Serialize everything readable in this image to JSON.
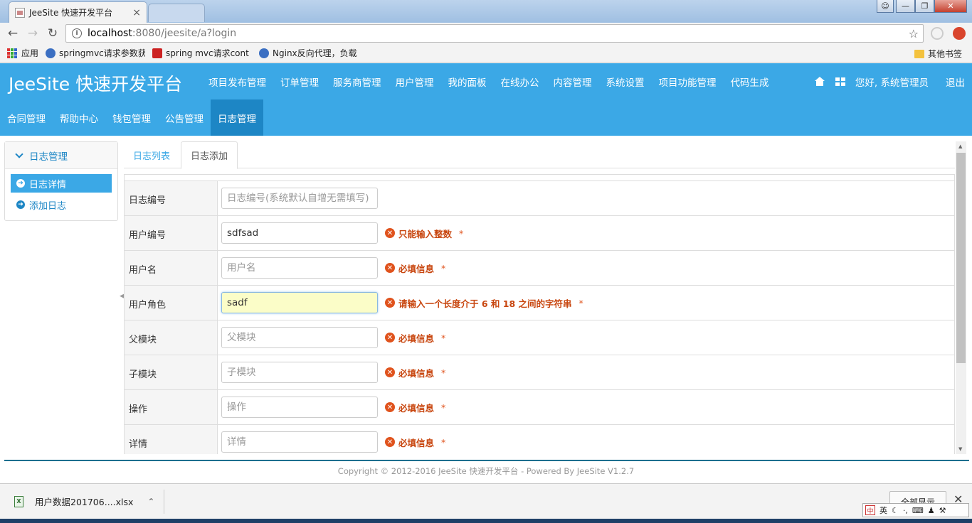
{
  "browser": {
    "tab_title": "JeeSite 快速开发平台",
    "tab_close": "×",
    "url_host": "localhost",
    "url_rest": ":8080/jeesite/a?login",
    "bookmarks": [
      {
        "label": "应用",
        "color": "#d33"
      },
      {
        "label": "springmvc请求参数获",
        "color": "#3b6fc2"
      },
      {
        "label": "spring mvc请求cont",
        "color": "#c22"
      },
      {
        "label": "Nginx反向代理，负载",
        "color": "#3b6fc2"
      }
    ],
    "other_bookmarks": "其他书签"
  },
  "app": {
    "brand": "JeeSite 快速开发平台",
    "main_nav": [
      "项目发布管理",
      "订单管理",
      "服务商管理",
      "用户管理",
      "我的面板",
      "在线办公",
      "内容管理",
      "系统设置",
      "项目功能管理",
      "代码生成"
    ],
    "greeting": "您好, 系统管理员",
    "logout": "退出",
    "sub_nav": [
      {
        "label": "合同管理",
        "active": false
      },
      {
        "label": "帮助中心",
        "active": false
      },
      {
        "label": "钱包管理",
        "active": false
      },
      {
        "label": "公告管理",
        "active": false
      },
      {
        "label": "日志管理",
        "active": true
      }
    ],
    "accent_color": "#3ba8e6"
  },
  "sidebar": {
    "title": "日志管理",
    "items": [
      {
        "label": "日志详情",
        "active": true
      },
      {
        "label": "添加日志",
        "active": false
      }
    ]
  },
  "content": {
    "tabs": [
      {
        "label": "日志列表",
        "active": false
      },
      {
        "label": "日志添加",
        "active": true
      }
    ],
    "form": [
      {
        "label": "日志编号",
        "value": "",
        "placeholder": "日志编号(系统默认自增无需填写)",
        "error": "",
        "required": false,
        "focused": false
      },
      {
        "label": "用户编号",
        "value": "sdfsad",
        "placeholder": "",
        "error": "只能输入整数",
        "required": true,
        "focused": false
      },
      {
        "label": "用户名",
        "value": "",
        "placeholder": "用户名",
        "error": "必填信息",
        "required": true,
        "focused": false
      },
      {
        "label": "用户角色",
        "value": "sadf",
        "placeholder": "",
        "error": "请输入一个长度介于 6 和 18 之间的字符串",
        "required": true,
        "focused": true
      },
      {
        "label": "父模块",
        "value": "",
        "placeholder": "父模块",
        "error": "必填信息",
        "required": true,
        "focused": false
      },
      {
        "label": "子模块",
        "value": "",
        "placeholder": "子模块",
        "error": "必填信息",
        "required": true,
        "focused": false
      },
      {
        "label": "操作",
        "value": "",
        "placeholder": "操作",
        "error": "必填信息",
        "required": true,
        "focused": false
      },
      {
        "label": "详情",
        "value": "",
        "placeholder": "详情",
        "error": "必填信息",
        "required": true,
        "focused": false
      }
    ],
    "required_mark": "*"
  },
  "footer": {
    "copyright": "Copyright © 2012-2016 JeeSite 快速开发平台 - Powered By JeeSite V1.2.7"
  },
  "downloads": {
    "file_name": "用户数据201706....xlsx",
    "show_all": "全部显示"
  },
  "ime": {
    "lang": "英"
  }
}
